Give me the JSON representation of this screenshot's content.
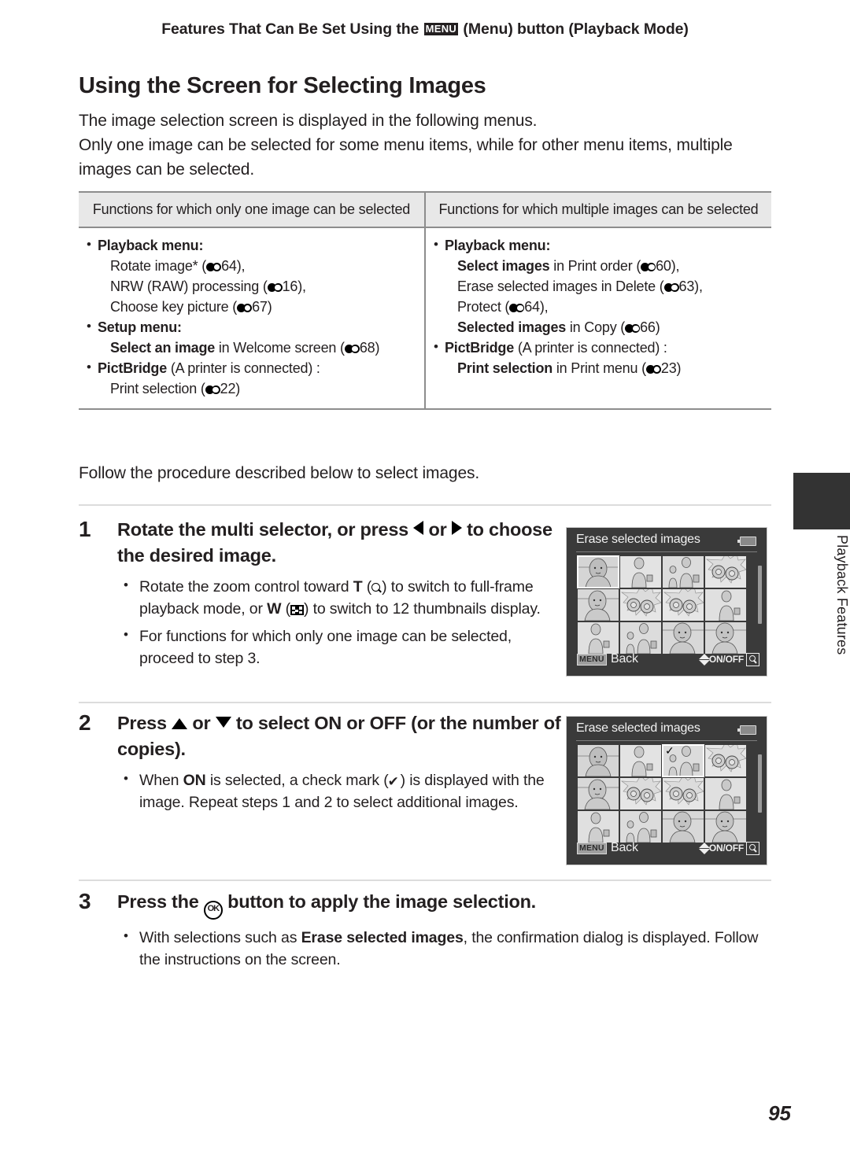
{
  "header": {
    "prefix": "Features That Can Be Set Using the ",
    "menu_glyph": "MENU",
    "suffix": " (Menu) button (Playback Mode)"
  },
  "section": {
    "title": "Using the Screen for Selecting Images",
    "intro_line1": "The image selection screen is displayed in the following menus.",
    "intro_line2": "Only one image can be selected for some menu items, while for other menu items, multiple images can be selected."
  },
  "table": {
    "headers": [
      "Functions for which only one image can be selected",
      "Functions for which multiple images can be selected"
    ],
    "left_column": {
      "groups": [
        {
          "label": "Playback menu:",
          "items": [
            {
              "pre": "Rotate image* (",
              "ref": "64",
              "post": "),"
            },
            {
              "pre": "NRW (RAW) processing (",
              "ref": "16",
              "post": "),"
            },
            {
              "pre": "Choose key picture (",
              "ref": "67",
              "post": ")"
            }
          ]
        },
        {
          "label": "Setup menu:",
          "items": [
            {
              "bold": "Select an image",
              "pre": " in Welcome screen (",
              "ref": "68",
              "post": ")"
            }
          ]
        },
        {
          "label": "PictBridge",
          "label_tail": " (A printer is connected) :",
          "items": [
            {
              "pre": "Print selection (",
              "ref": "22",
              "post": ")"
            }
          ]
        }
      ]
    },
    "right_column": {
      "groups": [
        {
          "label": "Playback menu:",
          "items": [
            {
              "bold": "Select images",
              "pre": " in Print order (",
              "ref": "60",
              "post": "),"
            },
            {
              "pre": "Erase selected images in Delete (",
              "ref": "63",
              "post": "),"
            },
            {
              "pre": "Protect (",
              "ref": "64",
              "post": "),"
            },
            {
              "bold": "Selected images",
              "pre": " in Copy (",
              "ref": "66",
              "post": ")"
            }
          ]
        },
        {
          "label": "PictBridge",
          "label_tail": " (A printer is connected) :",
          "items": [
            {
              "bold": "Print selection",
              "pre": " in Print menu (",
              "ref": "23",
              "post": ")"
            }
          ]
        }
      ]
    }
  },
  "follow_text": "Follow the procedure described below to select images.",
  "steps": [
    {
      "number": "1",
      "heading_part1": "Rotate the multi selector, or press ",
      "heading_part2": " or ",
      "heading_part3": " to choose the desired image.",
      "bullets": [
        "Rotate the zoom control toward T (magnify) to switch to full-frame playback mode, or W (thumbnails) to switch to 12 thumbnails display.",
        "For functions for which only one image can be selected, proceed to step 3."
      ],
      "b1_a": "Rotate the zoom control toward ",
      "b1_T": "T",
      "b1_b": " (",
      "b1_c": ") to switch to full-frame playback mode, or ",
      "b1_W": "W",
      "b1_d": " (",
      "b1_e": ") to switch to 12 thumbnails display.",
      "b2": "For functions for which only one image can be selected, proceed to step 3."
    },
    {
      "number": "2",
      "h_a": "Press ",
      "h_b": " or ",
      "h_c": " to select ",
      "h_on": "ON",
      "h_d": " or ",
      "h_off": "OFF",
      "h_e": " (or the number of copies).",
      "b_a": "When ",
      "b_on": "ON",
      "b_b": " is selected, a check mark (",
      "b_c": ") is displayed with the image. Repeat steps 1 and 2 to select additional images."
    },
    {
      "number": "3",
      "h_a": "Press the ",
      "h_ok": "OK",
      "h_b": " button to apply the image selection.",
      "b_a": "With selections such as ",
      "b_bold": "Erase selected images",
      "b_b": ", the confirmation dialog is displayed. Follow the instructions on the screen."
    }
  ],
  "camera_screens": [
    {
      "title": "Erase selected images",
      "back_label": "Back",
      "menu_tag": "MENU",
      "onoff_label": "ON/OFF",
      "selected_index": 0,
      "checked_indexes": []
    },
    {
      "title": "Erase selected images",
      "back_label": "Back",
      "menu_tag": "MENU",
      "onoff_label": "ON/OFF",
      "selected_index": 2,
      "checked_indexes": [
        2
      ]
    }
  ],
  "side_tab": {
    "label": "Playback Features"
  },
  "page_number": "95",
  "colors": {
    "text": "#231f20",
    "table_header_bg": "#e8e8e8",
    "table_border": "#8d8d8d",
    "rule": "#dcdcdc",
    "screen_bg": "#3a3a3a",
    "tab_block": "#333333"
  }
}
